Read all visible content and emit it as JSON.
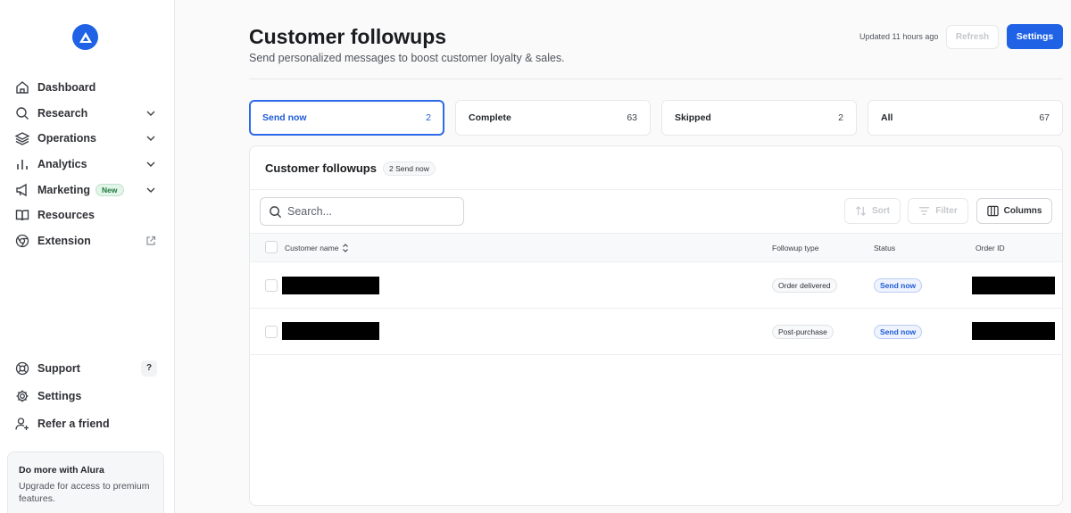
{
  "sidebar": {
    "items": [
      {
        "label": "Dashboard",
        "icon": "home-icon"
      },
      {
        "label": "Research",
        "icon": "search-icon"
      },
      {
        "label": "Operations",
        "icon": "layers-icon"
      },
      {
        "label": "Analytics",
        "icon": "bar-chart-icon"
      },
      {
        "label": "Marketing",
        "icon": "megaphone-icon",
        "badge": "New"
      },
      {
        "label": "Resources",
        "icon": "book-icon"
      },
      {
        "label": "Extension",
        "icon": "chrome-icon"
      }
    ],
    "bottom": [
      {
        "label": "Support",
        "icon": "lifebuoy-icon",
        "shortcut": "?"
      },
      {
        "label": "Settings",
        "icon": "gear-icon"
      },
      {
        "label": "Refer a friend",
        "icon": "user-plus-icon"
      }
    ],
    "promo": {
      "title": "Do more with Alura",
      "text": "Upgrade for access to premium features."
    }
  },
  "header": {
    "title": "Customer followups",
    "subtitle": "Send personalized messages to boost customer loyalty & sales.",
    "updated": "Updated 11 hours ago",
    "refresh_label": "Refresh",
    "settings_label": "Settings"
  },
  "tabs": [
    {
      "label": "Send now",
      "count": "2"
    },
    {
      "label": "Complete",
      "count": "63"
    },
    {
      "label": "Skipped",
      "count": "2"
    },
    {
      "label": "All",
      "count": "67"
    }
  ],
  "card": {
    "title": "Customer followups",
    "count_badge": "2 Send now",
    "search_placeholder": "Search...",
    "sort_label": "Sort",
    "filter_label": "Filter",
    "columns_label": "Columns",
    "table": {
      "headers": {
        "customer": "Customer name",
        "type": "Followup type",
        "status": "Status",
        "order": "Order ID"
      },
      "rows": [
        {
          "type": "Order delivered",
          "status": "Send now"
        },
        {
          "type": "Post-purchase",
          "status": "Send now"
        }
      ]
    }
  },
  "colors": {
    "accent": "#1f62e6",
    "active_tab_border": "#2d6ae8"
  }
}
